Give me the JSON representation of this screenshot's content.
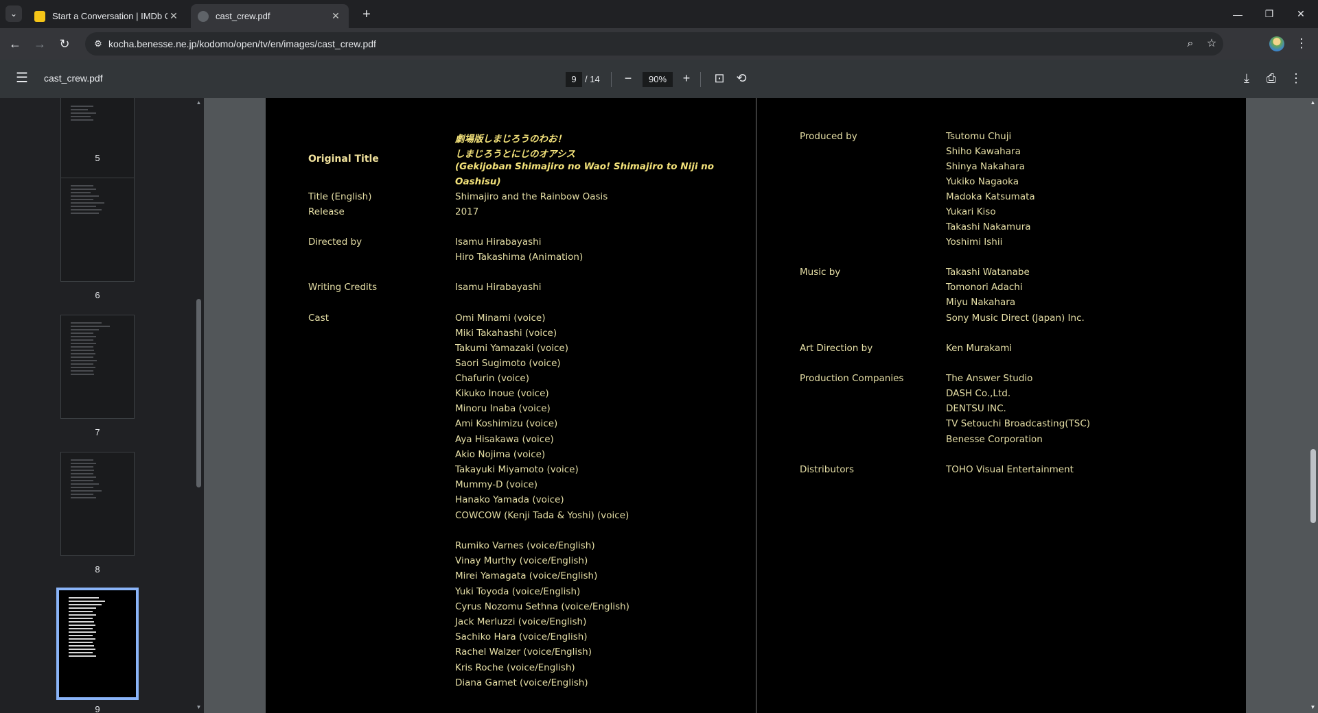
{
  "browser": {
    "tabs": [
      {
        "title": "Start a Conversation | IMDb Co",
        "icon": "imdb-icon"
      },
      {
        "title": "cast_crew.pdf",
        "icon": "globe-icon"
      }
    ],
    "url": "kocha.benesse.ne.jp/kodomo/open/tv/en/images/cast_crew.pdf"
  },
  "pdf_toolbar": {
    "filename": "cast_crew.pdf",
    "current_page": "9",
    "total_pages": "/ 14",
    "zoom": "90%"
  },
  "thumbnails": [
    {
      "number": "5"
    },
    {
      "number": "6"
    },
    {
      "number": "7"
    },
    {
      "number": "8"
    },
    {
      "number": "9"
    }
  ],
  "document": {
    "left": {
      "original_title_label": "Original Title",
      "original_title_lines": [
        "劇場版しまじろうのわお！",
        "しまじろうとにじのオアシス",
        "(Gekijoban Shimajiro no Wao! Shimajiro to Niji no",
        "Oashisu)"
      ],
      "title_english_label": "Title (English)",
      "title_english_value": "Shimajiro and the Rainbow Oasis",
      "release_label": "Release",
      "release_value": "2017",
      "directed_label": "Directed by",
      "directed_values": [
        "Isamu Hirabayashi",
        "Hiro Takashima  (Animation)"
      ],
      "writing_label": "Writing Credits",
      "writing_value": "Isamu Hirabayashi",
      "cast_label": "Cast",
      "cast_japanese": [
        "Omi Minami (voice)",
        "Miki Takahashi (voice)",
        "Takumi Yamazaki (voice)",
        "Saori Sugimoto  (voice)",
        "Chafurin  (voice)",
        "Kikuko Inoue  (voice)",
        "Minoru Inaba   (voice)",
        "Ami Koshimizu (voice)",
        "Aya Hisakawa  (voice)",
        "Akio Nojima  (voice)",
        "Takayuki Miyamoto  (voice)",
        "Mummy-D (voice)",
        "Hanako Yamada  (voice)",
        "COWCOW (Kenji Tada & Yoshi)  (voice)"
      ],
      "cast_english": [
        "Rumiko Varnes (voice/English)",
        "Vinay Murthy (voice/English)",
        "Mirei Yamagata (voice/English)",
        "Yuki Toyoda (voice/English)",
        "Cyrus Nozomu Sethna  (voice/English)",
        "Jack Merluzzi  (voice/English)",
        "Sachiko Hara  (voice/English)",
        "Rachel Walzer (voice/English)",
        "Kris Roche (voice/English)",
        "Diana Garnet  (voice/English)"
      ]
    },
    "right": {
      "produced_label": "Produced by",
      "produced_values": [
        "Tsutomu Chuji",
        "Shiho Kawahara",
        "Shinya Nakahara",
        "Yukiko Nagaoka",
        "Madoka Katsumata",
        "Yukari Kiso",
        "Takashi Nakamura",
        "Yoshimi Ishii"
      ],
      "music_label": "Music by",
      "music_values": [
        "Takashi Watanabe",
        "Tomonori Adachi",
        "Miyu Nakahara",
        "Sony Music Direct (Japan) Inc."
      ],
      "art_label": "Art Direction by",
      "art_value": "Ken Murakami",
      "companies_label": "Production Companies",
      "companies_values": [
        "The Answer Studio",
        "DASH Co.,Ltd.",
        "DENTSU INC.",
        "TV Setouchi Broadcasting(TSC)",
        "Benesse Corporation"
      ],
      "distributors_label": "Distributors",
      "distributors_value": "TOHO Visual Entertainment"
    }
  }
}
